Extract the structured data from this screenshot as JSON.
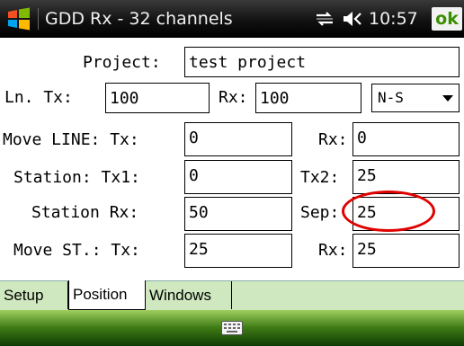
{
  "titlebar": {
    "app_title": "GDD Rx - 32 channels",
    "clock": "10:57",
    "ok_label": "ok",
    "icons": [
      "windows-logo-icon",
      "network-icon",
      "volume-icon"
    ]
  },
  "form": {
    "project_label": "Project:",
    "project_value": "test project",
    "ln_tx_label": "Ln. Tx:",
    "ln_tx_value": "100",
    "ln_rx_label": "Rx:",
    "ln_rx_value": "100",
    "direction_value": "N-S",
    "move_line_tx_label": "Move LINE: Tx:",
    "move_line_tx_value": "0",
    "move_line_rx_label": "Rx:",
    "move_line_rx_value": "0",
    "station_tx1_label": "Station: Tx1:",
    "station_tx1_value": "0",
    "tx2_label": "Tx2:",
    "tx2_value": "25",
    "station_rx_label": "Station Rx:",
    "station_rx_value": "50",
    "sep_label": "Sep:",
    "sep_value": "25",
    "move_st_tx_label": "Move ST.: Tx:",
    "move_st_tx_value": "25",
    "move_st_rx_label": "Rx:",
    "move_st_rx_value": "25"
  },
  "tabs": [
    {
      "label": "Setup"
    },
    {
      "label": "Position"
    },
    {
      "label": "Windows"
    }
  ],
  "active_tab": "Position",
  "colors": {
    "ok_text": "#3a8f00",
    "highlight_circle": "#e00000",
    "tab_strip": "#cfe8bf"
  }
}
